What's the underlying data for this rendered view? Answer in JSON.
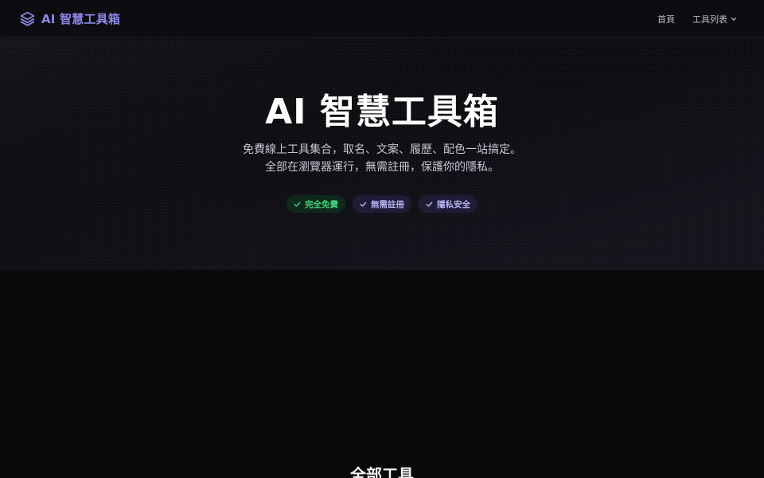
{
  "header": {
    "brand": "AI 智慧工具箱",
    "brand_icon": "layers-icon",
    "nav": {
      "home": "首頁",
      "tools": "工具列表",
      "tools_icon": "chevron-down-icon"
    }
  },
  "hero": {
    "title": "AI 智慧工具箱",
    "subtitle_line1": "免費線上工具集合，取名、文案、履歷、配色一站搞定。",
    "subtitle_line2": "全部在瀏覽器運行，無需註冊，保護你的隱私。",
    "badges": [
      {
        "label": "完全免費",
        "icon": "check-icon",
        "color": "#3fd27a"
      },
      {
        "label": "無需註冊",
        "icon": "check-icon",
        "color": "#b5b0f2"
      },
      {
        "label": "隱私安全",
        "icon": "check-icon",
        "color": "#b5b0f2"
      }
    ]
  },
  "section": {
    "title": "全部工具"
  },
  "colors": {
    "accent": "#8d87e6",
    "background": "#0a0a0c",
    "success": "#3fd27a"
  }
}
